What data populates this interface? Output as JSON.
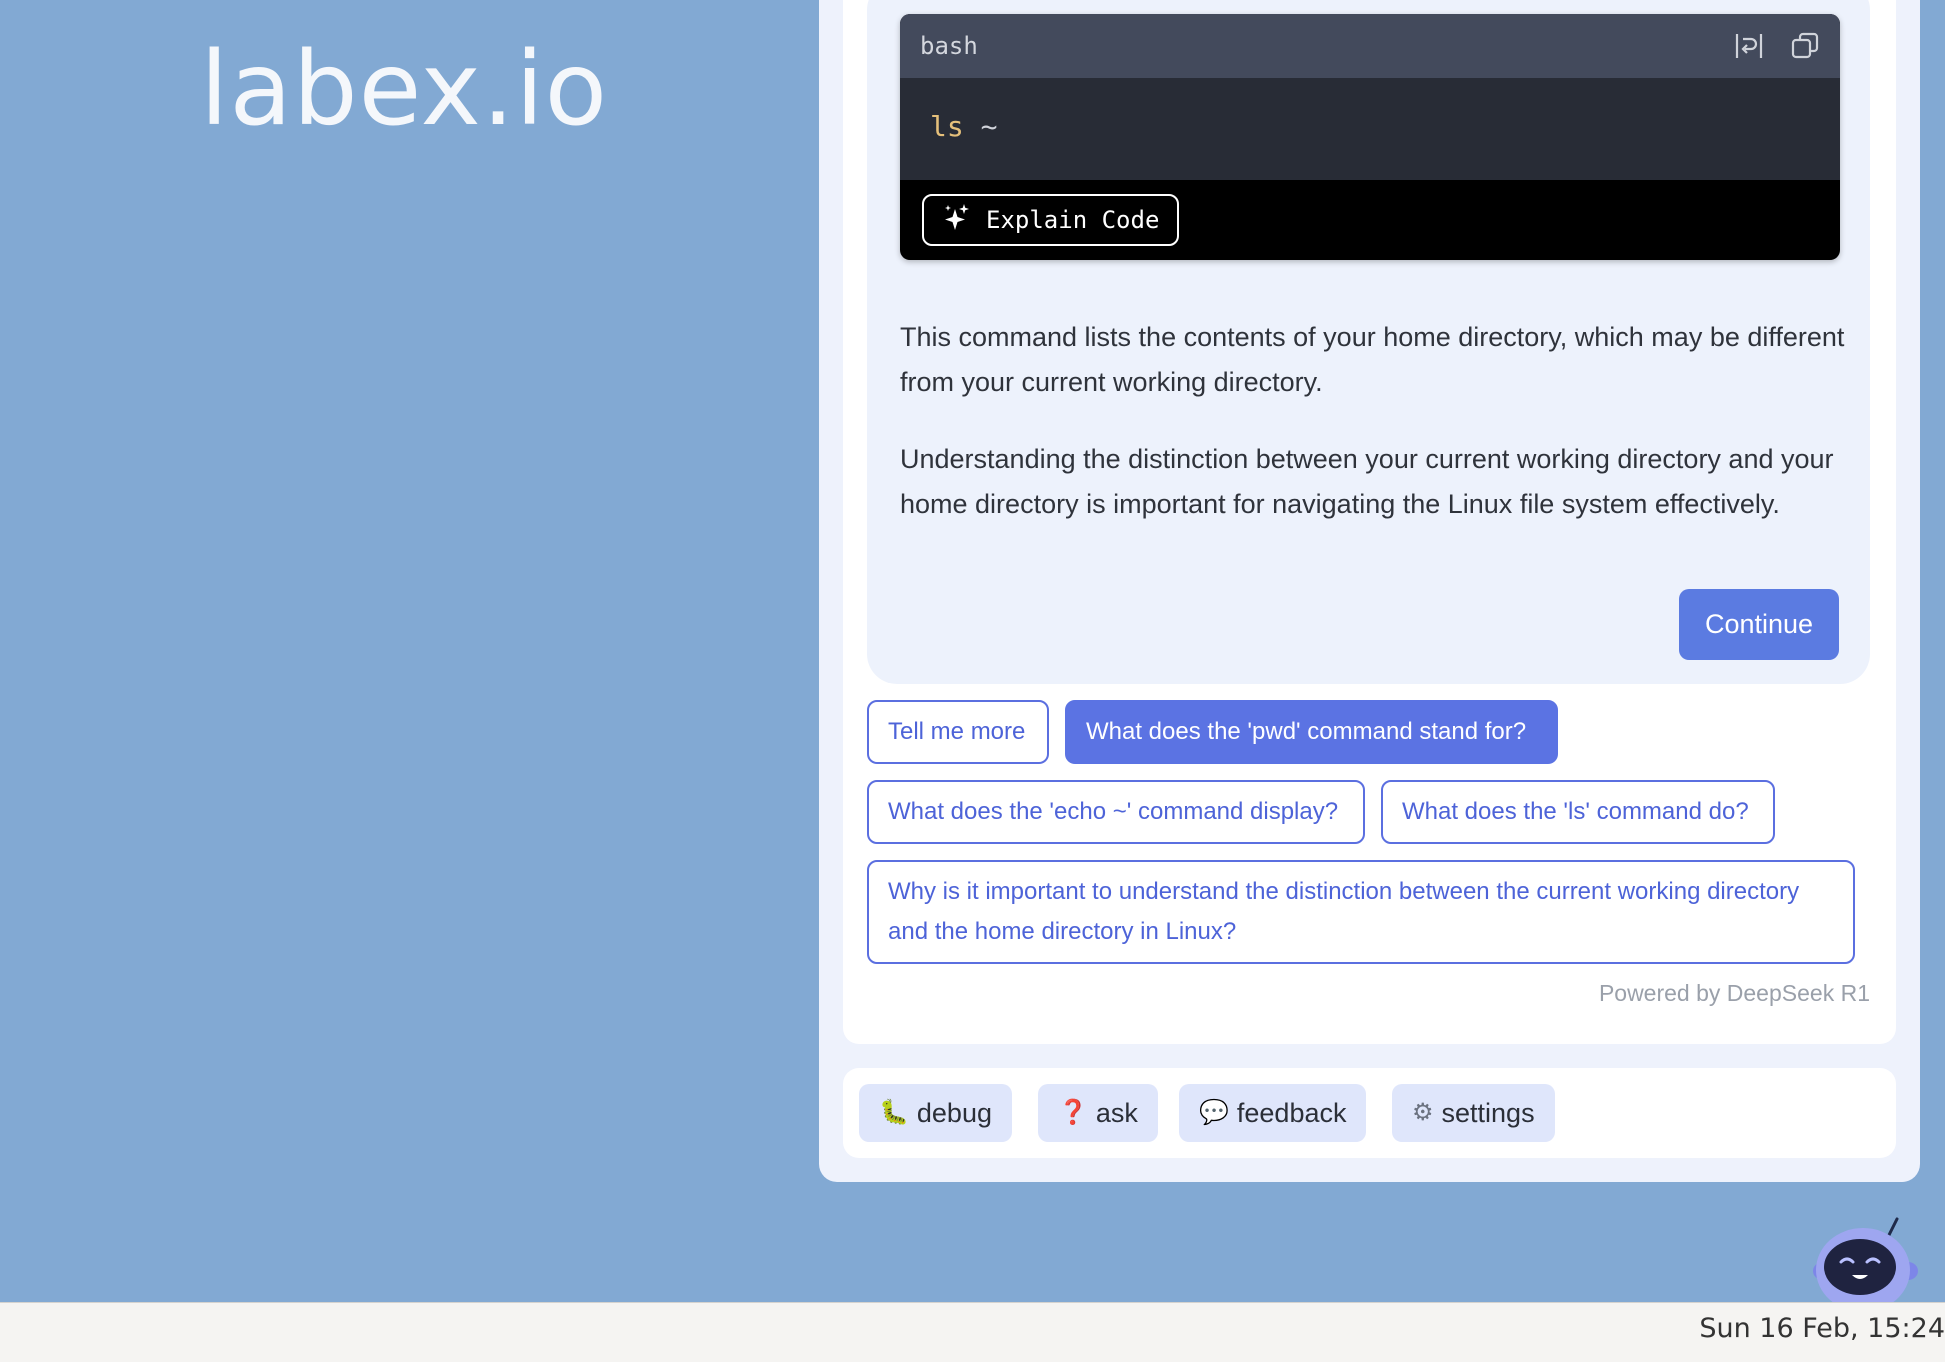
{
  "brand": {
    "logo_text": "labex.io"
  },
  "code_block": {
    "language": "bash",
    "command": "ls",
    "argument": " ~",
    "wrap_icon": "wrap-lines-icon",
    "copy_icon": "copy-icon",
    "explain_label": "Explain Code",
    "explain_icon": "sparkles-icon"
  },
  "message": {
    "paragraph_1": "This command lists the contents of your home directory, which may be different from your current working directory.",
    "paragraph_2": "Understanding the distinction between your current working directory and your home directory is important for navigating the Linux file system effectively.",
    "continue_label": "Continue"
  },
  "suggestions": [
    {
      "label": "Tell me more",
      "filled": false
    },
    {
      "label": "What does the 'pwd' command stand for?",
      "filled": true
    },
    {
      "label": "What does the 'echo ~' command display?",
      "filled": false
    },
    {
      "label": "What does the 'ls' command do?",
      "filled": false
    },
    {
      "label": "Why is it important to understand the distinction between the current working directory and the home directory in Linux?",
      "filled": false
    }
  ],
  "powered_by": "Powered by DeepSeek R1",
  "toolbar": {
    "debug": {
      "icon": "bug-icon",
      "glyph": "🐛",
      "label": "debug"
    },
    "ask": {
      "icon": "question-icon",
      "glyph": "❓",
      "label": "ask"
    },
    "feedback": {
      "icon": "speech-bubble-icon",
      "glyph": "💬",
      "label": "feedback"
    },
    "settings": {
      "icon": "gear-icon",
      "glyph": "⚙",
      "label": "settings"
    }
  },
  "taskbar": {
    "clock": "Sun 16 Feb, 15:24"
  },
  "assistant": {
    "icon": "robot-avatar-icon"
  },
  "colors": {
    "background": "#82a9d3",
    "accent": "#5b73e3",
    "chip_border": "#5b6fe0",
    "code_command": "#e5c07b"
  }
}
